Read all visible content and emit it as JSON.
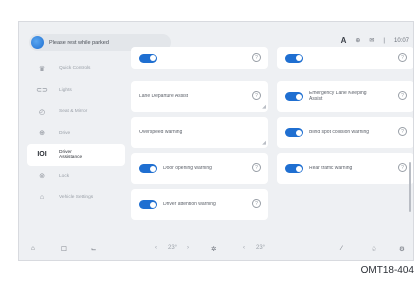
{
  "topbar": {
    "vehicle_label": "Please rest while parked",
    "status": [
      "A",
      "⊕",
      "✉",
      "|",
      "10:07"
    ]
  },
  "sidebar": {
    "items": [
      {
        "icon": "♛",
        "label": "Quick Controls",
        "active": false
      },
      {
        "icon": "⊂⊃",
        "label": "Lights",
        "active": false
      },
      {
        "icon": "◴",
        "label": "Seat & Mirror",
        "active": false
      },
      {
        "icon": "⊕",
        "label": "Drive",
        "active": false
      },
      {
        "icon": "IOI",
        "label": "Driver\nAssistance",
        "active": true
      },
      {
        "icon": "⊚",
        "label": "Lock",
        "active": false
      },
      {
        "icon": "⌂",
        "label": "Vehicle Settings",
        "active": false
      }
    ]
  },
  "cards": [
    {
      "col": 0,
      "row": 0,
      "toggle": true,
      "text": "",
      "info": true
    },
    {
      "col": 1,
      "row": 0,
      "toggle": true,
      "text": "",
      "info": true
    },
    {
      "col": 0,
      "row": 1,
      "toggle": false,
      "text": "Lane Departure Assist",
      "info": true,
      "corner": true
    },
    {
      "col": 1,
      "row": 1,
      "toggle": true,
      "text": "Emergency Lane Keeping\nAssist",
      "info": true
    },
    {
      "col": 0,
      "row": 2,
      "toggle": false,
      "text": "Overspeed warning",
      "info": false,
      "corner": true
    },
    {
      "col": 1,
      "row": 2,
      "toggle": true,
      "text": "Blind spot collision warning",
      "info": true
    },
    {
      "col": 0,
      "row": 3,
      "toggle": true,
      "text": "Door opening warning",
      "info": true
    },
    {
      "col": 1,
      "row": 3,
      "toggle": true,
      "text": "Rear traffic warning",
      "info": true
    },
    {
      "col": 0,
      "row": 4,
      "toggle": true,
      "text": "Driver attention warning",
      "info": true
    }
  ],
  "bottombar": {
    "home_icon": "⌂",
    "square_icon": "☐",
    "seat_icon": "⌙",
    "left_temp_down": "‹",
    "left_temp": "23°",
    "left_temp_up": "›",
    "fan": "✲",
    "right_temp_down": "‹",
    "right_temp": "23°",
    "right_temp_up": "›",
    "wiper": "⁄",
    "bell": "♤",
    "gear": "⚙"
  },
  "caption": "OMT18-404"
}
